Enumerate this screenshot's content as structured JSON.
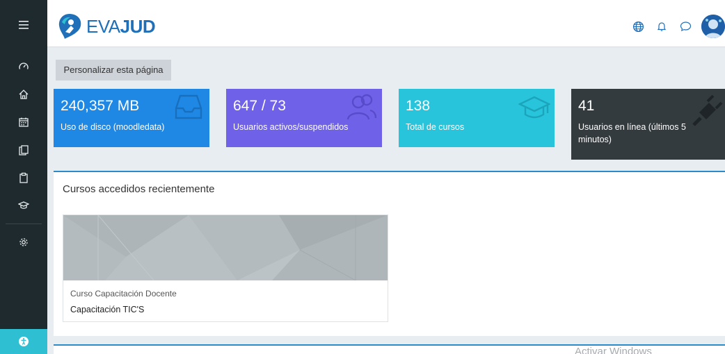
{
  "brand": {
    "name_light": "EVA",
    "name_bold": "JUD",
    "color": "#1f6fb9"
  },
  "sidebar": {
    "items": [
      {
        "icon": "dashboard-icon"
      },
      {
        "icon": "home-icon"
      },
      {
        "icon": "calendar-icon"
      },
      {
        "icon": "files-icon"
      },
      {
        "icon": "clipboard-icon"
      },
      {
        "icon": "graduation-cap-icon"
      },
      {
        "icon": "settings-icon"
      }
    ],
    "accessibility_icon": "accessibility-icon"
  },
  "header": {
    "icons": [
      "language-globe-icon",
      "notifications-bell-icon",
      "messages-chat-icon",
      "user-avatar"
    ]
  },
  "customize_button": "Personalizar esta página",
  "stats": [
    {
      "value": "240,357 MB",
      "label": "Uso de disco (moodledata)",
      "color": "#1f88e5",
      "icon": "inbox-icon"
    },
    {
      "value": "647 / 73",
      "label": "Usuarios activos/suspendidos",
      "color": "#7062e8",
      "icon": "users-icon"
    },
    {
      "value": "138",
      "label": "Total de cursos",
      "color": "#27c4dc",
      "icon": "graduation-cap-icon"
    },
    {
      "value": "41",
      "label": "Usuarios en línea (últimos 5 minutos)",
      "color": "#343b3f",
      "icon": "plug-icon"
    }
  ],
  "recent_courses": {
    "title": "Cursos accedidos recientemente",
    "courses": [
      {
        "category": "Curso Capacitación Docente",
        "name": "Capacitación TIC'S"
      }
    ]
  },
  "watermark": "Activar Windows"
}
